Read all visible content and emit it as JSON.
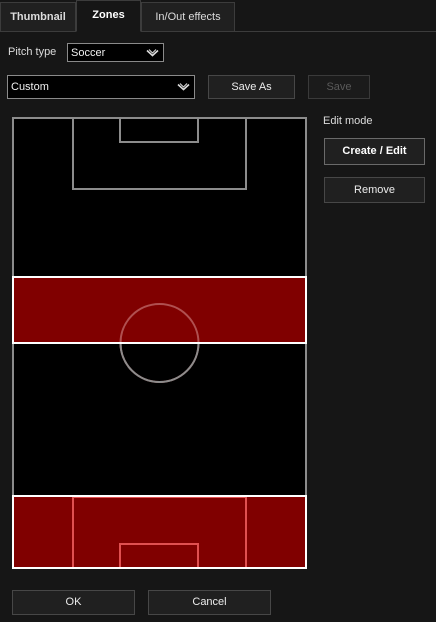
{
  "tabs": [
    {
      "label": "Thumbnail",
      "active": false
    },
    {
      "label": "Zones",
      "active": true
    },
    {
      "label": "In/Out effects",
      "active": false
    }
  ],
  "pitch_type": {
    "label": "Pitch type",
    "value": "Soccer"
  },
  "preset": {
    "value": "Custom",
    "save_as_label": "Save As",
    "save_label": "Save",
    "save_enabled": false
  },
  "edit_mode": {
    "label": "Edit mode",
    "create_edit_label": "Create / Edit",
    "remove_label": "Remove"
  },
  "pitch": {
    "colors": {
      "field": "#000000",
      "lines": "#8c8c8c",
      "zone_fill": "#800000",
      "zone_border": "#ffffff",
      "zone_lines": "#e05050"
    },
    "zones": [
      {
        "name": "middle zone"
      },
      {
        "name": "bottom goal zone"
      }
    ]
  },
  "footer": {
    "ok_label": "OK",
    "cancel_label": "Cancel"
  },
  "colors": {
    "background": "#161616",
    "tab_bg": "#202020",
    "button_bg": "#202020"
  }
}
